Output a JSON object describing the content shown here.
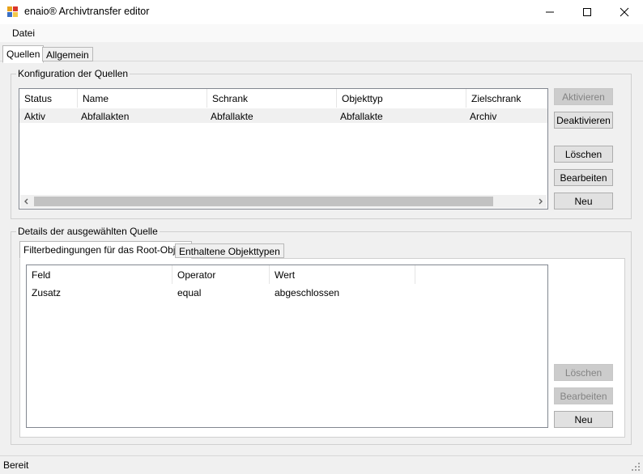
{
  "window": {
    "title": "enaio® Archivtransfer editor",
    "icon": "enaio-app-icon"
  },
  "menu": {
    "items": [
      "Datei"
    ]
  },
  "main_tabs": [
    "Quellen",
    "Allgemein"
  ],
  "sources_group": {
    "title": "Konfiguration der Quellen",
    "columns": [
      "Status",
      "Name",
      "Schrank",
      "Objekttyp",
      "Zielschrank"
    ],
    "rows": [
      [
        "Aktiv",
        "Abfallakten",
        "Abfallakte",
        "Abfallakte",
        "Archiv"
      ]
    ],
    "buttons": {
      "activate": "Aktivieren",
      "deactivate": "Deaktivieren",
      "delete": "Löschen",
      "edit": "Bearbeiten",
      "new": "Neu"
    }
  },
  "details_group": {
    "title": "Details der ausgewählten Quelle",
    "tabs": [
      "Filterbedingungen für das Root-Objekt",
      "Enthaltene Objekttypen"
    ],
    "columns": [
      "Feld",
      "Operator",
      "Wert"
    ],
    "rows": [
      [
        "Zusatz",
        "equal",
        "abgeschlossen"
      ]
    ],
    "buttons": {
      "delete": "Löschen",
      "edit": "Bearbeiten",
      "new": "Neu"
    }
  },
  "status": {
    "text": "Bereit"
  },
  "colors": {
    "selected_row": "#f0f0f0",
    "list_border": "#828790",
    "button_face": "#e1e1e1"
  }
}
